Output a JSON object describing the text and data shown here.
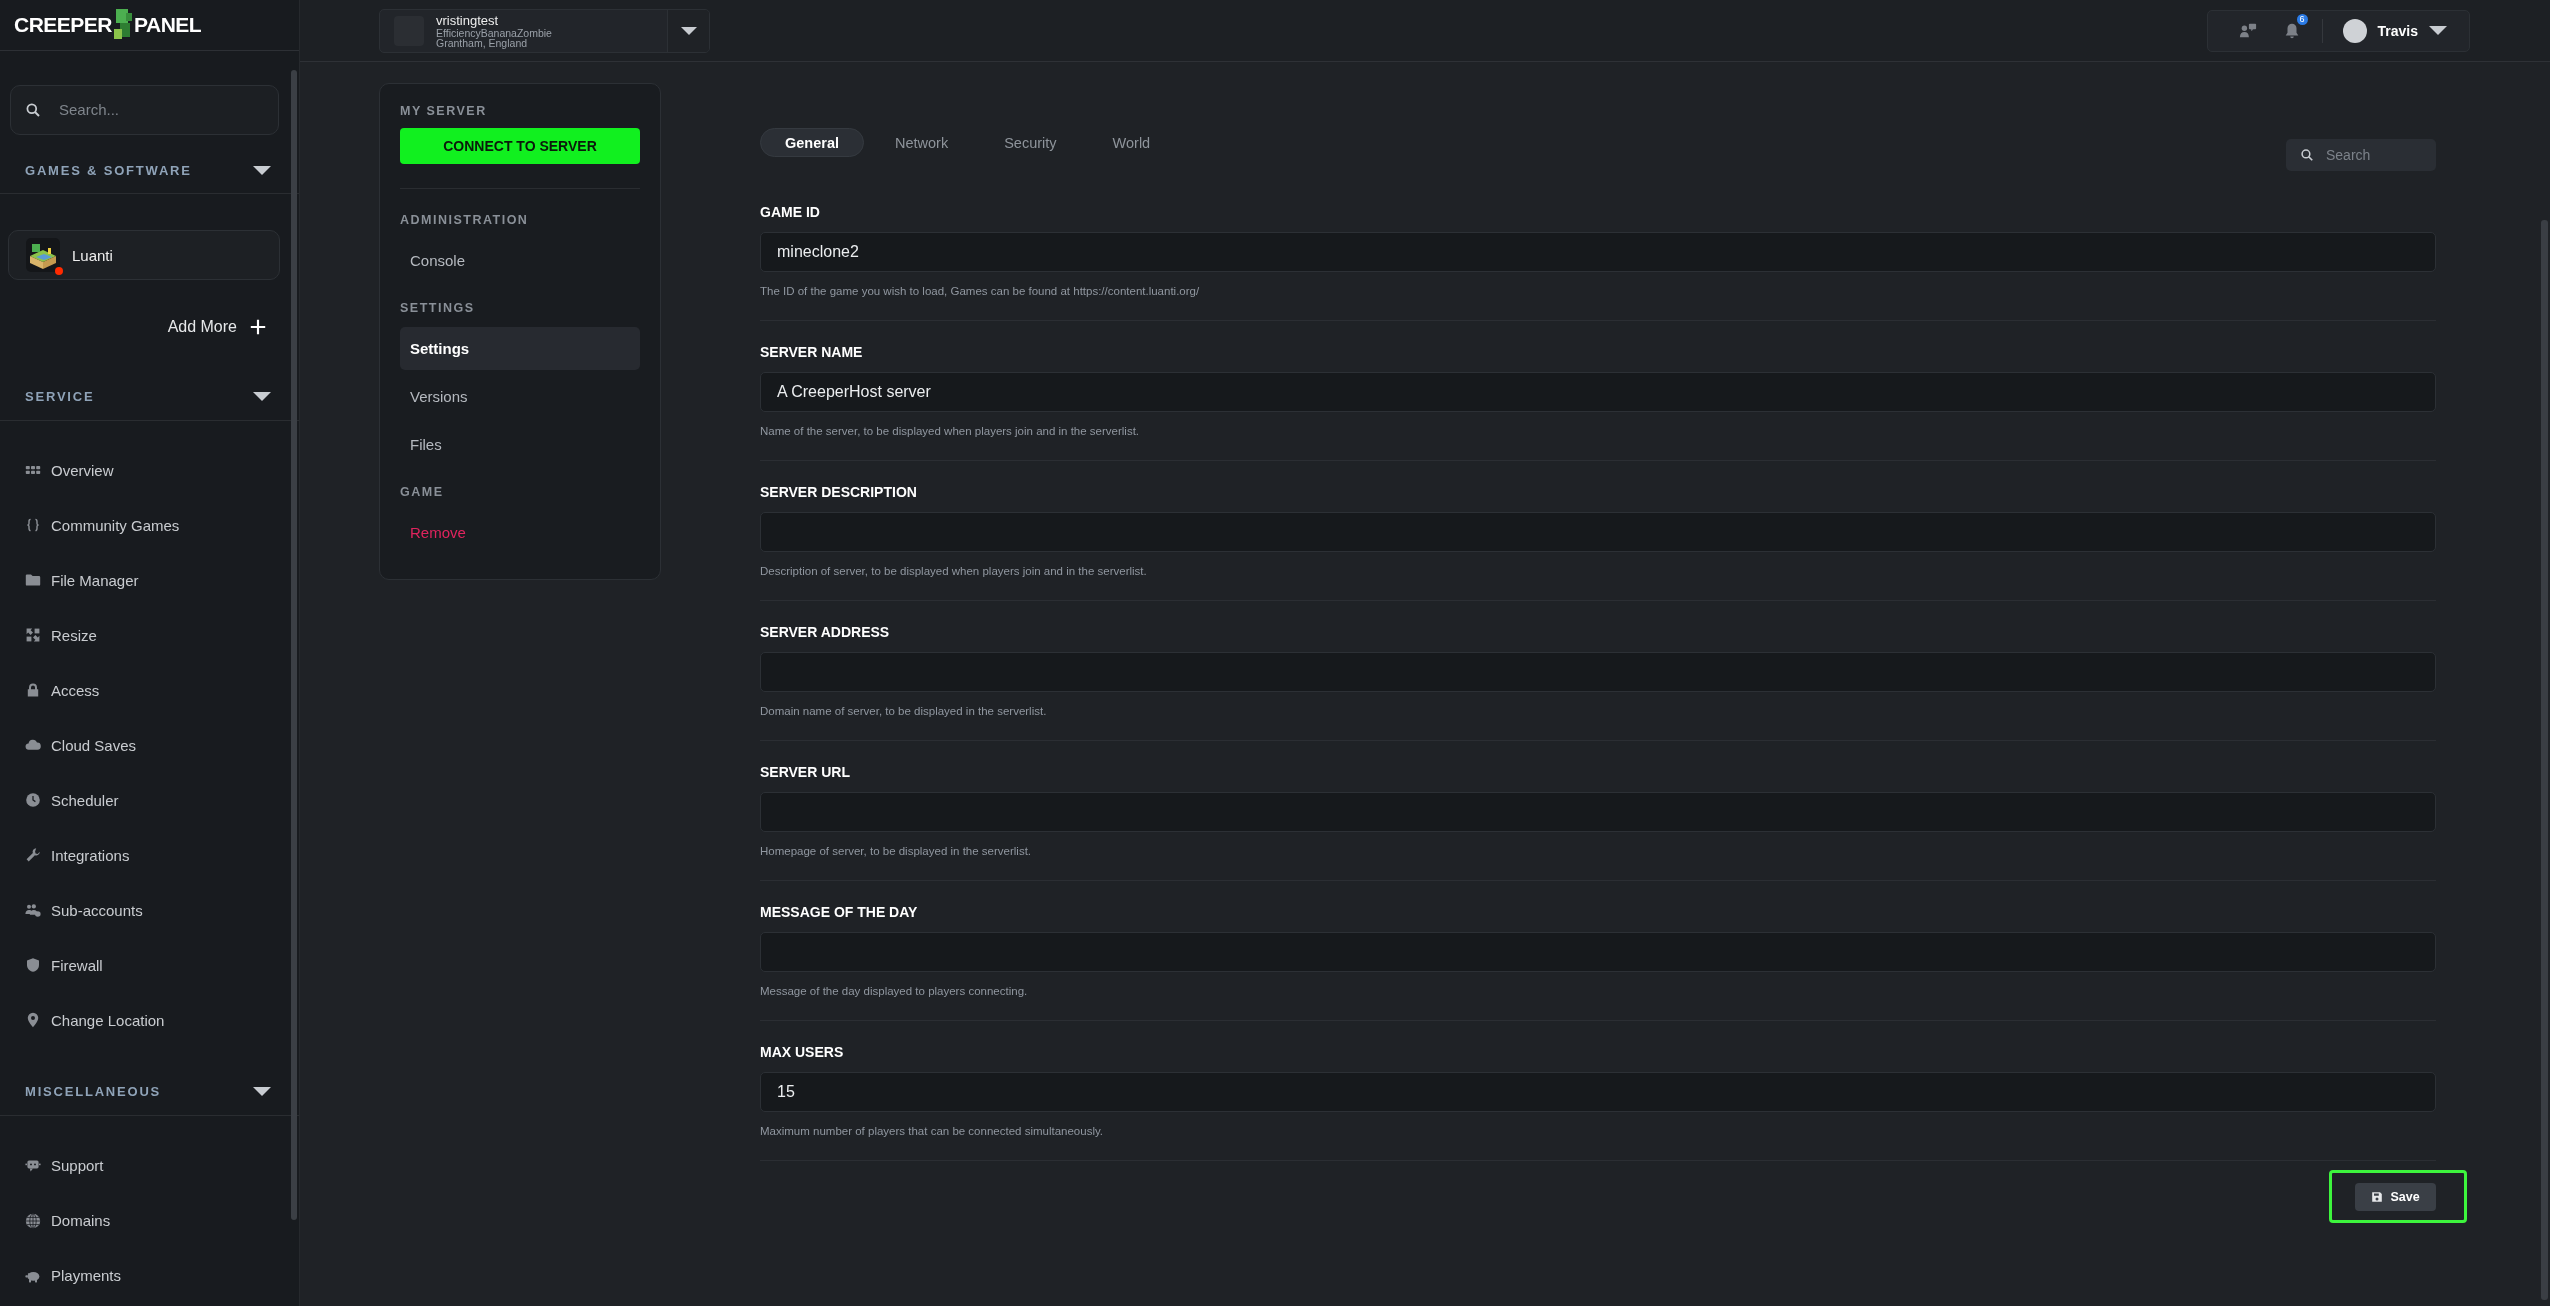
{
  "logo": {
    "left": "CREEPER",
    "right": "PANEL"
  },
  "sidebar": {
    "search": {
      "placeholder": "Search..."
    },
    "sections": [
      {
        "title": "GAMES & SOFTWARE",
        "expanded": true,
        "kind": "games",
        "games": [
          {
            "name": "Luanti",
            "color": "#ff2a00"
          }
        ],
        "add_label": "Add More"
      },
      {
        "title": "SERVICE",
        "expanded": true,
        "kind": "links",
        "items": [
          {
            "label": "Overview"
          },
          {
            "label": "Community Games"
          },
          {
            "label": "File Manager"
          },
          {
            "label": "Resize"
          },
          {
            "label": "Access"
          },
          {
            "label": "Cloud Saves"
          },
          {
            "label": "Scheduler"
          },
          {
            "label": "Integrations"
          },
          {
            "label": "Sub-accounts"
          },
          {
            "label": "Firewall"
          },
          {
            "label": "Change Location"
          }
        ]
      },
      {
        "title": "MISCELLANEOUS",
        "expanded": true,
        "kind": "links",
        "items": [
          {
            "label": "Support"
          },
          {
            "label": "Domains"
          },
          {
            "label": "Playments"
          }
        ]
      }
    ]
  },
  "topbar": {
    "server": {
      "name": "vristingtest",
      "subtitle": "EfficiencyBananaZombie",
      "location": "Grantham, England"
    },
    "notifications": {
      "count": "6"
    },
    "user": {
      "name": "Travis"
    }
  },
  "server_nav": {
    "title": "MY SERVER",
    "connect_label": "CONNECT TO SERVER",
    "groups": [
      {
        "title": "ADMINISTRATION",
        "items": [
          {
            "label": "Console",
            "selected": false,
            "kind": "normal"
          }
        ]
      },
      {
        "title": "SETTINGS",
        "items": [
          {
            "label": "Settings",
            "selected": true,
            "kind": "normal"
          },
          {
            "label": "Versions",
            "selected": false,
            "kind": "normal"
          },
          {
            "label": "Files",
            "selected": false,
            "kind": "normal"
          }
        ]
      },
      {
        "title": "GAME",
        "items": [
          {
            "label": "Remove",
            "selected": false,
            "kind": "danger"
          }
        ]
      }
    ]
  },
  "settings": {
    "tabs": [
      {
        "label": "General",
        "selected": true
      },
      {
        "label": "Network",
        "selected": false
      },
      {
        "label": "Security",
        "selected": false
      },
      {
        "label": "World",
        "selected": false
      }
    ],
    "search": {
      "placeholder": "Search"
    },
    "fields": [
      {
        "label": "GAME ID",
        "value": "mineclone2",
        "help": "The ID of the game you wish to load, Games can be found at https://content.luanti.org/"
      },
      {
        "label": "SERVER NAME",
        "value": "A CreeperHost server",
        "help": "Name of the server, to be displayed when players join and in the serverlist."
      },
      {
        "label": "SERVER DESCRIPTION",
        "help": "Description of server, to be displayed when players join and in the serverlist."
      },
      {
        "label": "SERVER ADDRESS",
        "help": "Domain name of server, to be displayed in the serverlist."
      },
      {
        "label": "SERVER URL",
        "help": "Homepage of server, to be displayed in the serverlist."
      },
      {
        "label": "MESSAGE OF THE DAY",
        "help": "Message of the day displayed to players connecting."
      },
      {
        "label": "MAX USERS",
        "value": "15",
        "help": "Maximum number of players that can be connected simultaneously."
      }
    ],
    "save": {
      "label": "Save",
      "highlighted": true
    }
  }
}
